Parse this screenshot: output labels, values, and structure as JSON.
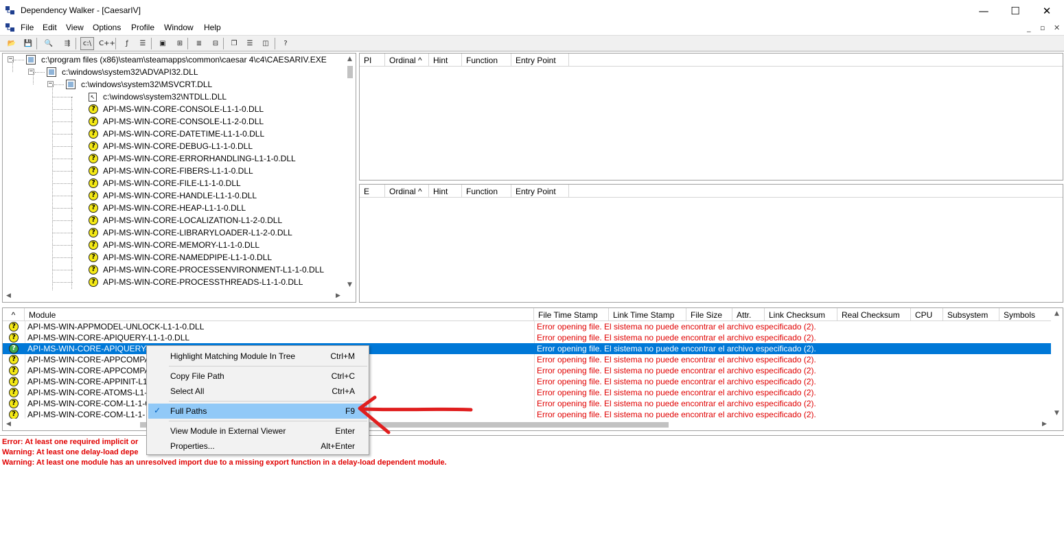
{
  "window": {
    "title": "Dependency Walker - [CaesarIV]",
    "controls": {
      "minimize": "—",
      "maximize": "☐",
      "close": "✕"
    }
  },
  "menubar": {
    "items": [
      "File",
      "Edit",
      "View",
      "Options",
      "Profile",
      "Window",
      "Help"
    ],
    "mdi_controls": {
      "minimize": "_",
      "restore": "▫",
      "close": "✕"
    }
  },
  "toolbar": {
    "buttons": [
      {
        "icon": "open-folder-icon",
        "glyph": "📂"
      },
      {
        "icon": "save-icon",
        "glyph": "💾"
      },
      {
        "icon": "find-icon",
        "glyph": "🔍"
      },
      {
        "icon": "hierarchy-icon",
        "glyph": "⇶"
      },
      {
        "icon": "full-paths-icon",
        "glyph": "c:\\"
      },
      {
        "icon": "undecorate-cpp-icon",
        "glyph": "C++"
      },
      {
        "icon": "view-function-icon",
        "glyph": "ƒ"
      },
      {
        "icon": "properties-icon",
        "glyph": "☰"
      },
      {
        "icon": "system-info-icon",
        "glyph": "▣"
      },
      {
        "icon": "external-viewer-icon",
        "glyph": "⊞"
      },
      {
        "icon": "expand-all-icon",
        "glyph": "≣"
      },
      {
        "icon": "collapse-all-icon",
        "glyph": "⊟"
      },
      {
        "icon": "cascade-icon",
        "glyph": "❐"
      },
      {
        "icon": "tile-horizontal-icon",
        "glyph": "☰"
      },
      {
        "icon": "tile-vertical-icon",
        "glyph": "◫"
      },
      {
        "icon": "context-help-icon",
        "glyph": "?"
      }
    ]
  },
  "tree": {
    "nodes": [
      {
        "label": "c:\\program files (x86)\\steam\\steamapps\\common\\caesar 4\\c4\\CAESARIV.EXE",
        "icon": "module-icon",
        "depth": 0,
        "expander": "−"
      },
      {
        "label": "c:\\windows\\system32\\ADVAPI32.DLL",
        "icon": "module-icon",
        "depth": 1,
        "expander": "−"
      },
      {
        "label": "c:\\windows\\system32\\MSVCRT.DLL",
        "icon": "module-icon",
        "depth": 2,
        "expander": "−"
      },
      {
        "label": "c:\\windows\\system32\\NTDLL.DLL",
        "icon": "forwarded-module-icon",
        "depth": 3,
        "expander": ""
      },
      {
        "label": "API-MS-WIN-CORE-CONSOLE-L1-1-0.DLL",
        "icon": "missing-module-icon",
        "depth": 3,
        "expander": ""
      },
      {
        "label": "API-MS-WIN-CORE-CONSOLE-L1-2-0.DLL",
        "icon": "missing-module-icon",
        "depth": 3,
        "expander": ""
      },
      {
        "label": "API-MS-WIN-CORE-DATETIME-L1-1-0.DLL",
        "icon": "missing-module-icon",
        "depth": 3,
        "expander": ""
      },
      {
        "label": "API-MS-WIN-CORE-DEBUG-L1-1-0.DLL",
        "icon": "missing-module-icon",
        "depth": 3,
        "expander": ""
      },
      {
        "label": "API-MS-WIN-CORE-ERRORHANDLING-L1-1-0.DLL",
        "icon": "missing-module-icon",
        "depth": 3,
        "expander": ""
      },
      {
        "label": "API-MS-WIN-CORE-FIBERS-L1-1-0.DLL",
        "icon": "missing-module-icon",
        "depth": 3,
        "expander": ""
      },
      {
        "label": "API-MS-WIN-CORE-FILE-L1-1-0.DLL",
        "icon": "missing-module-icon",
        "depth": 3,
        "expander": ""
      },
      {
        "label": "API-MS-WIN-CORE-HANDLE-L1-1-0.DLL",
        "icon": "missing-module-icon",
        "depth": 3,
        "expander": ""
      },
      {
        "label": "API-MS-WIN-CORE-HEAP-L1-1-0.DLL",
        "icon": "missing-module-icon",
        "depth": 3,
        "expander": ""
      },
      {
        "label": "API-MS-WIN-CORE-LOCALIZATION-L1-2-0.DLL",
        "icon": "missing-module-icon",
        "depth": 3,
        "expander": ""
      },
      {
        "label": "API-MS-WIN-CORE-LIBRARYLOADER-L1-2-0.DLL",
        "icon": "missing-module-icon",
        "depth": 3,
        "expander": ""
      },
      {
        "label": "API-MS-WIN-CORE-MEMORY-L1-1-0.DLL",
        "icon": "missing-module-icon",
        "depth": 3,
        "expander": ""
      },
      {
        "label": "API-MS-WIN-CORE-NAMEDPIPE-L1-1-0.DLL",
        "icon": "missing-module-icon",
        "depth": 3,
        "expander": ""
      },
      {
        "label": "API-MS-WIN-CORE-PROCESSENVIRONMENT-L1-1-0.DLL",
        "icon": "missing-module-icon",
        "depth": 3,
        "expander": ""
      },
      {
        "label": "API-MS-WIN-CORE-PROCESSTHREADS-L1-1-0.DLL",
        "icon": "missing-module-icon",
        "depth": 3,
        "expander": ""
      }
    ]
  },
  "imports_list": {
    "columns": [
      "PI",
      "Ordinal ^",
      "Hint",
      "Function",
      "Entry Point"
    ]
  },
  "exports_list": {
    "columns": [
      "E",
      "Ordinal ^",
      "Hint",
      "Function",
      "Entry Point"
    ]
  },
  "modules_list": {
    "columns": [
      "^",
      "Module",
      "File Time Stamp",
      "Link Time Stamp",
      "File Size",
      "Attr.",
      "Link Checksum",
      "Real Checksum",
      "CPU",
      "Subsystem",
      "Symbols"
    ],
    "rows": [
      {
        "module": "API-MS-WIN-APPMODEL-UNLOCK-L1-1-0.DLL",
        "error": "Error opening file. El sistema no puede encontrar el archivo especificado (2).",
        "selected": false
      },
      {
        "module": "API-MS-WIN-CORE-APIQUERY-L1-1-0.DLL",
        "error": "Error opening file. El sistema no puede encontrar el archivo especificado (2).",
        "selected": false
      },
      {
        "module": "API-MS-WIN-CORE-APIQUERY-L",
        "error": "Error opening file. El sistema no puede encontrar el archivo especificado (2).",
        "selected": true
      },
      {
        "module": "API-MS-WIN-CORE-APPCOMPA",
        "error": "Error opening file. El sistema no puede encontrar el archivo especificado (2).",
        "selected": false
      },
      {
        "module": "API-MS-WIN-CORE-APPCOMPA",
        "error": "Error opening file. El sistema no puede encontrar el archivo especificado (2).",
        "selected": false
      },
      {
        "module": "API-MS-WIN-CORE-APPINIT-L1-",
        "error": "Error opening file. El sistema no puede encontrar el archivo especificado (2).",
        "selected": false
      },
      {
        "module": "API-MS-WIN-CORE-ATOMS-L1-1",
        "error": "Error opening file. El sistema no puede encontrar el archivo especificado (2).",
        "selected": false
      },
      {
        "module": "API-MS-WIN-CORE-COM-L1-1-0",
        "error": "Error opening file. El sistema no puede encontrar el archivo especificado (2).",
        "selected": false
      },
      {
        "module": "API-MS-WIN-CORE-COM-L1-1-",
        "error": "Error opening file. El sistema no puede encontrar el archivo especificado (2).",
        "selected": false
      }
    ]
  },
  "log": {
    "lines": [
      "Error: At least one required implicit or",
      "Warning: At least one delay-load depe",
      "Warning: At least one module has an unresolved import due to a missing export function in a delay-load dependent module."
    ]
  },
  "context_menu": {
    "items": [
      {
        "label": "Highlight Matching Module In Tree",
        "shortcut": "Ctrl+M",
        "checked": false,
        "highlighted": false
      },
      {
        "label": "Copy File Path",
        "shortcut": "Ctrl+C",
        "checked": false,
        "highlighted": false
      },
      {
        "label": "Select All",
        "shortcut": "Ctrl+A",
        "checked": false,
        "highlighted": false
      },
      {
        "label": "Full Paths",
        "shortcut": "F9",
        "checked": true,
        "highlighted": true
      },
      {
        "label": "View Module in External Viewer",
        "shortcut": "Enter",
        "checked": false,
        "highlighted": false
      },
      {
        "label": "Properties...",
        "shortcut": "Alt+Enter",
        "checked": false,
        "highlighted": false
      }
    ],
    "check_glyph": "✓"
  },
  "colors": {
    "error_text": "#e00000",
    "selection": "#0078d7",
    "menu_highlight": "#91c9f7",
    "annotation_arrow": "#e01e1e"
  }
}
